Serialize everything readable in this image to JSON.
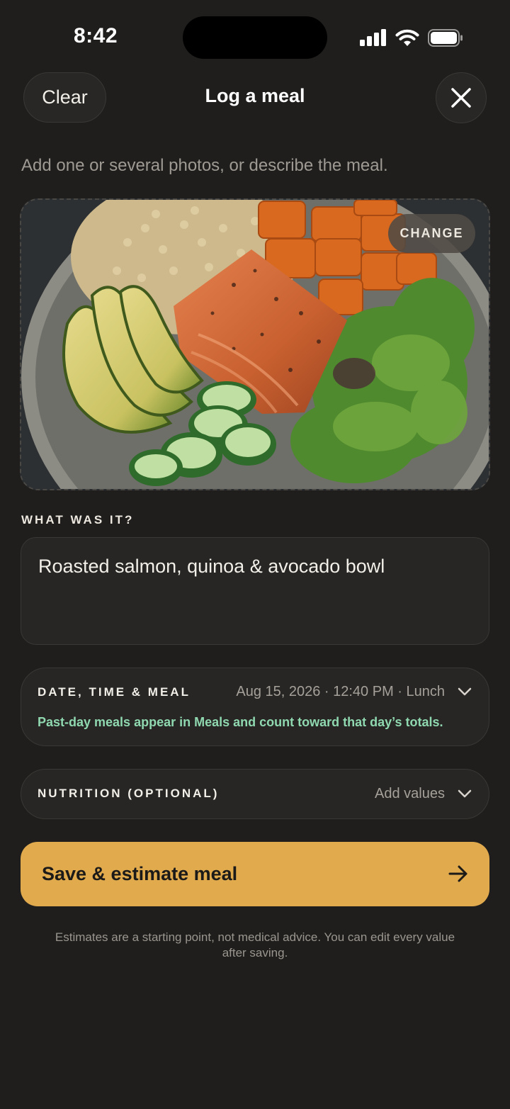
{
  "status_bar": {
    "time": "8:42"
  },
  "header": {
    "clear_label": "Clear",
    "title": "Log a meal"
  },
  "helper_text": "Add one or several photos, or describe the meal.",
  "photo": {
    "change_label": "CHANGE"
  },
  "what_was_it": {
    "label": "WHAT WAS IT?",
    "value": "Roasted salmon, quinoa & avocado bowl"
  },
  "date_section": {
    "label": "DATE, TIME & MEAL",
    "value": "Aug 15, 2026 · 12:40 PM · Lunch",
    "note": "Past-day meals appear in Meals and count toward that day’s totals."
  },
  "nutrition_section": {
    "label": "NUTRITION (OPTIONAL)",
    "value": "Add values"
  },
  "save_button": {
    "label": "Save & estimate meal"
  },
  "disclaimer": "Estimates are a starting point, not medical advice. You can edit every value after saving.",
  "colors": {
    "background": "#1f1e1c",
    "accent": "#e0aa4d",
    "note_green": "#8fd8b0"
  }
}
